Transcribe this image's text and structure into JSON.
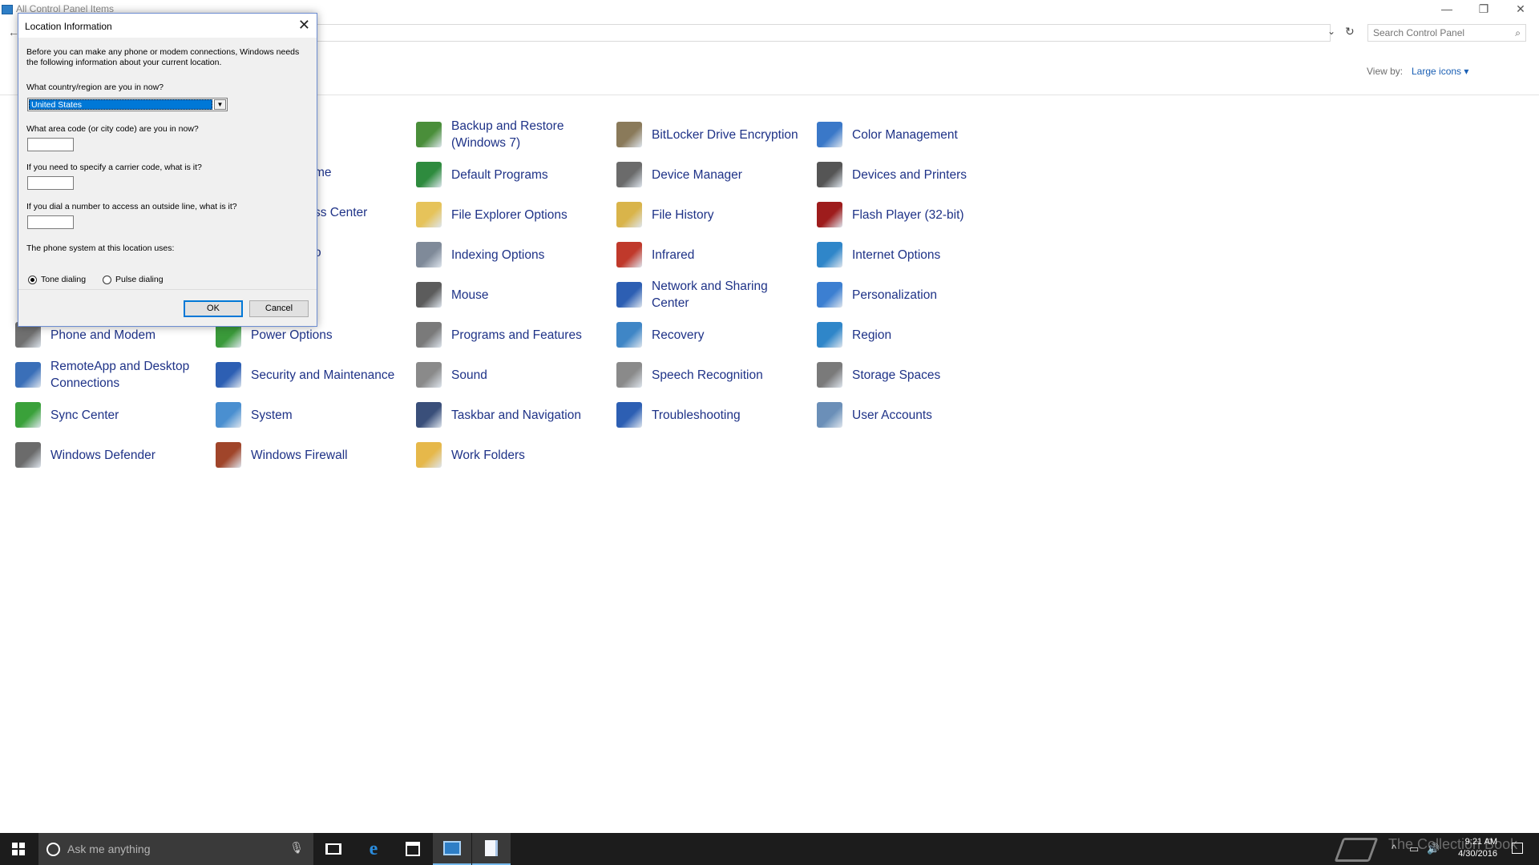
{
  "window": {
    "title": "All Control Panel Items",
    "search_placeholder": "Search Control Panel",
    "view_by_label": "View by:",
    "view_by_value": "Large icons ▾"
  },
  "items": [
    {
      "label": "Backup and Restore (Windows 7)",
      "icon": "backup-restore-icon",
      "color": "#4a8e3a"
    },
    {
      "label": "BitLocker Drive Encryption",
      "icon": "bitlocker-icon",
      "color": "#8a7a5a"
    },
    {
      "label": "Color Management",
      "icon": "color-management-icon",
      "color": "#3a78c8"
    },
    {
      "label": "Default Programs",
      "icon": "default-programs-icon",
      "color": "#2e8b3e"
    },
    {
      "label": "Device Manager",
      "icon": "device-manager-icon",
      "color": "#6b6b6b"
    },
    {
      "label": "Devices and Printers",
      "icon": "devices-printers-icon",
      "color": "#555555"
    },
    {
      "label": "File Explorer Options",
      "icon": "file-explorer-options-icon",
      "color": "#e6c35a"
    },
    {
      "label": "File History",
      "icon": "file-history-icon",
      "color": "#d9b44a"
    },
    {
      "label": "Flash Player (32-bit)",
      "icon": "flash-player-icon",
      "color": "#9e1c1c"
    },
    {
      "label": "Indexing Options",
      "icon": "indexing-options-icon",
      "color": "#7f8a99"
    },
    {
      "label": "Infrared",
      "icon": "infrared-icon",
      "color": "#c0392b"
    },
    {
      "label": "Internet Options",
      "icon": "internet-options-icon",
      "color": "#2f86c9"
    },
    {
      "label": "Mouse",
      "icon": "mouse-icon",
      "color": "#5c5c5c"
    },
    {
      "label": "Network and Sharing Center",
      "icon": "network-sharing-icon",
      "color": "#2d5fb3"
    },
    {
      "label": "Personalization",
      "icon": "personalization-icon",
      "color": "#3c7fd1"
    },
    {
      "label": "Phone and Modem",
      "icon": "phone-modem-icon",
      "color": "#707070"
    },
    {
      "label": "Power Options",
      "icon": "power-options-icon",
      "color": "#3a9a3a"
    },
    {
      "label": "Programs and Features",
      "icon": "programs-features-icon",
      "color": "#7a7a7a"
    },
    {
      "label": "Recovery",
      "icon": "recovery-icon",
      "color": "#3f86c6"
    },
    {
      "label": "Region",
      "icon": "region-icon",
      "color": "#2f86c9"
    },
    {
      "label": "RemoteApp and Desktop Connections",
      "icon": "remoteapp-icon",
      "color": "#3a6fb8"
    },
    {
      "label": "Security and Maintenance",
      "icon": "security-maintenance-icon",
      "color": "#2d5fb3"
    },
    {
      "label": "Sound",
      "icon": "sound-icon",
      "color": "#8a8a8a"
    },
    {
      "label": "Speech Recognition",
      "icon": "speech-recognition-icon",
      "color": "#8a8a8a"
    },
    {
      "label": "Storage Spaces",
      "icon": "storage-spaces-icon",
      "color": "#7a7a7a"
    },
    {
      "label": "Sync Center",
      "icon": "sync-center-icon",
      "color": "#3aa13a"
    },
    {
      "label": "System",
      "icon": "system-icon",
      "color": "#4a8fd0"
    },
    {
      "label": "Taskbar and Navigation",
      "icon": "taskbar-navigation-icon",
      "color": "#3a4f7a"
    },
    {
      "label": "Troubleshooting",
      "icon": "troubleshooting-icon",
      "color": "#2d5fb3"
    },
    {
      "label": "User Accounts",
      "icon": "user-accounts-icon",
      "color": "#6b8fb8"
    },
    {
      "label": "Windows Defender",
      "icon": "windows-defender-icon",
      "color": "#6b6b6b"
    },
    {
      "label": "Windows Firewall",
      "icon": "windows-firewall-icon",
      "color": "#a0452a"
    },
    {
      "label": "Work Folders",
      "icon": "work-folders-icon",
      "color": "#e6b84a"
    }
  ],
  "partial_items": [
    {
      "label": "me"
    },
    {
      "label": "ss Center"
    },
    {
      "label": "o"
    }
  ],
  "dialog": {
    "title": "Location Information",
    "intro": "Before you can make any phone or modem connections, Windows needs the following information about your current location.",
    "country_question": "What country/region are you in now?",
    "country_value": "United States",
    "area_code_question": "What area code (or city code) are you in now?",
    "area_code_value": "",
    "carrier_question": "If you need to specify a carrier code, what is it?",
    "carrier_value": "",
    "outside_line_question": "If you dial a number to access an outside line, what is it?",
    "outside_line_value": "",
    "phone_system_question": "The phone system at this location uses:",
    "tone_label": "Tone dialing",
    "pulse_label": "Pulse dialing",
    "ok_label": "OK",
    "cancel_label": "Cancel"
  },
  "taskbar": {
    "search_text": "Ask me anything",
    "watermark": "The Collection Book",
    "time": "9:21 AM",
    "date": "4/30/2016"
  }
}
